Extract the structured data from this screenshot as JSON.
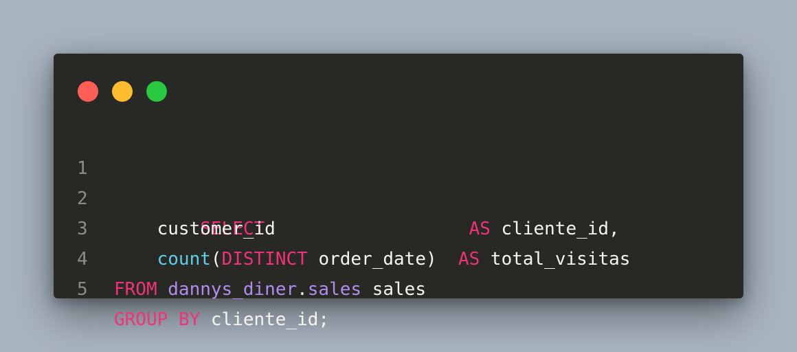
{
  "window": {
    "controls": [
      {
        "name": "close",
        "color": "#ff5f57"
      },
      {
        "name": "minimize",
        "color": "#febc2e"
      },
      {
        "name": "maximize",
        "color": "#28c840"
      }
    ]
  },
  "colors": {
    "background": "#a8b4c0",
    "editor": "#282824",
    "keyword": "#f0327a",
    "function": "#5ecfe8",
    "identifier": "#b28cf0",
    "text": "#f5f5f0",
    "line_number": "#8d8d86"
  },
  "code": {
    "lines": [
      {
        "number": "1",
        "tokens": [
          {
            "type": "kw",
            "text": "SELECT"
          }
        ]
      },
      {
        "number": "2",
        "tokens": [
          {
            "type": "tx",
            "text": "    customer_id                  "
          },
          {
            "type": "kw",
            "text": "AS"
          },
          {
            "type": "tx",
            "text": " cliente_id,"
          }
        ]
      },
      {
        "number": "3",
        "tokens": [
          {
            "type": "tx",
            "text": "    "
          },
          {
            "type": "fn",
            "text": "count"
          },
          {
            "type": "tx",
            "text": "("
          },
          {
            "type": "kw",
            "text": "DISTINCT"
          },
          {
            "type": "tx",
            "text": " order_date)  "
          },
          {
            "type": "kw",
            "text": "AS"
          },
          {
            "type": "tx",
            "text": " total_visitas"
          }
        ]
      },
      {
        "number": "4",
        "tokens": [
          {
            "type": "kw",
            "text": "FROM"
          },
          {
            "type": "tx",
            "text": " "
          },
          {
            "type": "id",
            "text": "dannys_diner"
          },
          {
            "type": "tx",
            "text": "."
          },
          {
            "type": "id",
            "text": "sales"
          },
          {
            "type": "tx",
            "text": " sales"
          }
        ]
      },
      {
        "number": "5",
        "tokens": [
          {
            "type": "kw",
            "text": "GROUP BY"
          },
          {
            "type": "tx",
            "text": " cliente_id;"
          }
        ]
      }
    ]
  }
}
